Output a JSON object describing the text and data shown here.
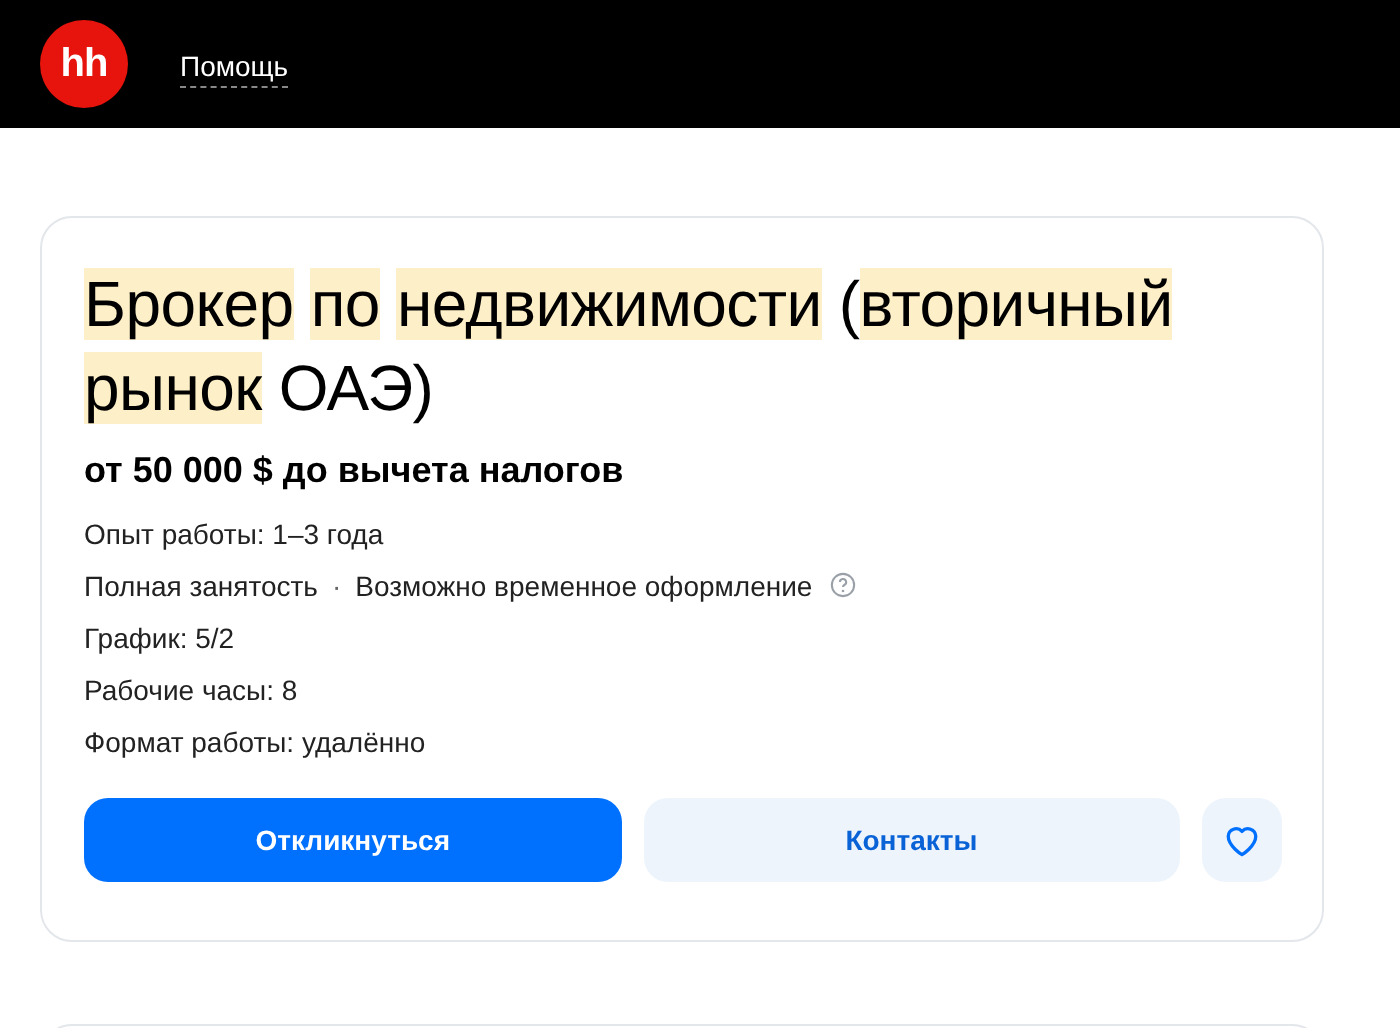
{
  "header": {
    "logo": "hh",
    "nav_link": "Помощь"
  },
  "vacancy": {
    "title_segments": [
      {
        "text": "Брокер",
        "highlighted": true
      },
      {
        "text": "по",
        "highlighted": true
      },
      {
        "text": "недвижимости",
        "highlighted": true
      },
      {
        "text": "(",
        "highlighted": false,
        "glue": true
      },
      {
        "text": "вторичный",
        "highlighted": true
      },
      {
        "text": "рынок",
        "highlighted": true
      },
      {
        "text": "ОАЭ)",
        "highlighted": false
      }
    ],
    "separator": "·",
    "salary": "от 50 000 $ до вычета налогов",
    "details": [
      {
        "parts": [
          "Опыт работы: 1–3 года"
        ]
      },
      {
        "parts": [
          "Полная занятость",
          "Возможно временное оформление"
        ],
        "help": true
      },
      {
        "parts": [
          "График: 5/2"
        ]
      },
      {
        "parts": [
          "Рабочие часы: 8"
        ]
      },
      {
        "parts": [
          "Формат работы: удалённо"
        ]
      }
    ],
    "apply_button": "Откликнуться",
    "contacts_button": "Контакты",
    "favorite": false
  }
}
